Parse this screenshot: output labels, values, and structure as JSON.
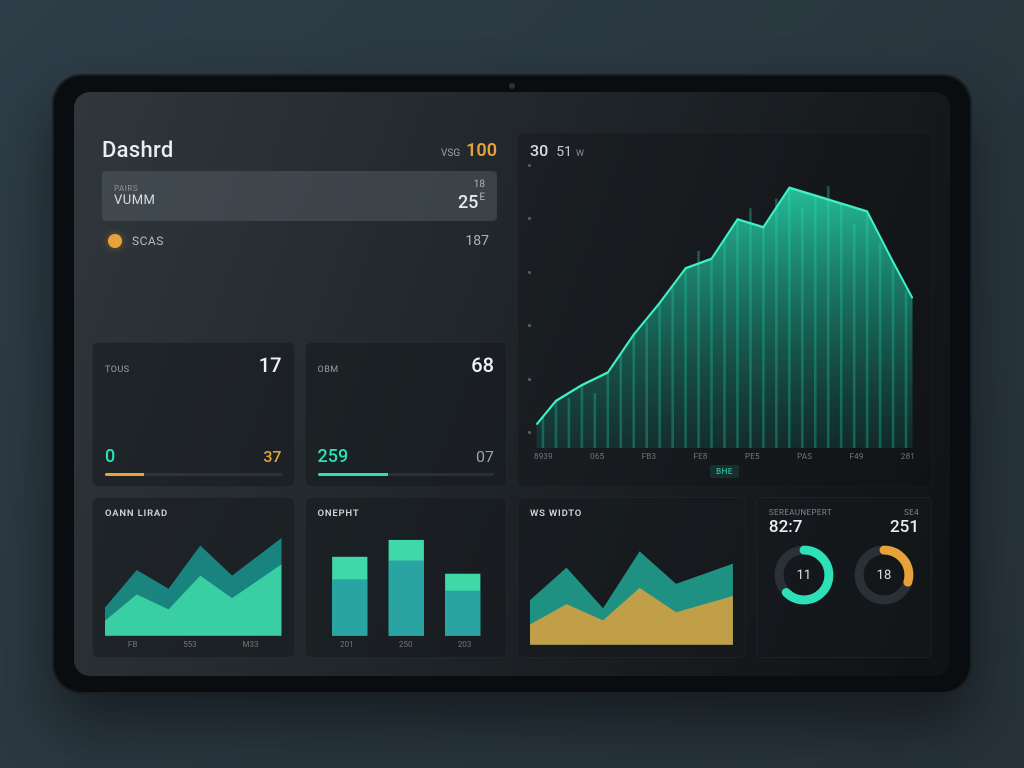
{
  "header": {
    "title": "Dashrd",
    "meta_label": "VSG",
    "meta_value": "100",
    "input_tiny": "PAIRS",
    "input_label": "VUMM",
    "input_small": "18",
    "input_main": "25",
    "input_sup": "E",
    "status_label": "SCAS",
    "status_value": "187"
  },
  "stat_cards": [
    {
      "label": "TOUS",
      "big": "17",
      "v1": "0",
      "v2": "37",
      "fill_pct": 22,
      "fill_color": "fill-orange",
      "v1_class": "teal",
      "v2_class": "orange"
    },
    {
      "label": "OBM",
      "big": "68",
      "v1": "259",
      "v2": "07",
      "fill_pct": 40,
      "fill_color": "fill-teal",
      "v1_class": "teal",
      "v2_class": "grey"
    }
  ],
  "big_chart": {
    "n1": "30",
    "n2": "51",
    "unit": "W",
    "badge": "BHE",
    "xticks": [
      "8939",
      "065",
      "FB3",
      "FE8",
      "PE5",
      "PAS",
      "F49",
      "281"
    ]
  },
  "mini_charts": {
    "a": {
      "title": "OANN LIRAD",
      "xticks": [
        "FB",
        "553",
        "M33"
      ]
    },
    "b": {
      "title": "ONEPHT",
      "xticks": [
        "201",
        "250",
        "203"
      ]
    },
    "c": {
      "title": "WS WIDTO",
      "xticks": [
        "",
        "",
        ""
      ]
    }
  },
  "kpi_panel": {
    "sub": "SEREAUNEPERT",
    "sub2": "SE4",
    "v1": "82:7",
    "v2": "251"
  },
  "donuts": [
    {
      "value": "11",
      "pct": 62,
      "color": "#2de0b8"
    },
    {
      "value": "18",
      "pct": 30,
      "color": "#e8a23a"
    }
  ],
  "chart_data": {
    "big_area": {
      "type": "area",
      "title": "",
      "x": [
        0,
        1,
        2,
        3,
        4,
        5,
        6,
        7,
        8,
        9,
        10,
        11,
        12,
        13,
        14,
        15,
        16,
        17,
        18,
        19,
        20,
        21,
        22,
        23,
        24,
        25,
        26,
        27,
        28,
        29
      ],
      "values": [
        8,
        12,
        14,
        18,
        16,
        20,
        24,
        30,
        34,
        40,
        46,
        52,
        60,
        58,
        64,
        72,
        78,
        70,
        82,
        88,
        80,
        86,
        90,
        84,
        76,
        82,
        70,
        64,
        58,
        50
      ],
      "ylim": [
        0,
        100
      ],
      "xticks": [
        "8939",
        "065",
        "FB3",
        "FE8",
        "PE5",
        "PAS",
        "F49",
        "281"
      ]
    },
    "mini_a": {
      "type": "area",
      "series": [
        {
          "name": "s1",
          "color": "#1aa0a0",
          "values": [
            30,
            55,
            40,
            70,
            50,
            80
          ]
        },
        {
          "name": "s2",
          "color": "#3fd9a8",
          "values": [
            20,
            40,
            30,
            55,
            35,
            60
          ]
        }
      ],
      "x": [
        0,
        1,
        2,
        3,
        4,
        5
      ],
      "ylim": [
        0,
        100
      ]
    },
    "mini_b": {
      "type": "bar",
      "categories": [
        "201",
        "250",
        "203"
      ],
      "series": [
        {
          "name": "a",
          "color": "#3fd9a8",
          "values": [
            70,
            85,
            55
          ]
        },
        {
          "name": "b",
          "color": "#2aa3a3",
          "values": [
            55,
            70,
            40
          ]
        }
      ],
      "ylim": [
        0,
        100
      ]
    },
    "mini_c": {
      "type": "area",
      "series": [
        {
          "name": "teal",
          "color": "#2bd3b0",
          "values": [
            40,
            60,
            35,
            70,
            50,
            65
          ]
        },
        {
          "name": "orange",
          "color": "#e8a23a",
          "values": [
            20,
            35,
            25,
            45,
            30,
            40
          ]
        }
      ],
      "x": [
        0,
        1,
        2,
        3,
        4,
        5
      ],
      "ylim": [
        0,
        100
      ]
    },
    "donuts": [
      {
        "type": "pie",
        "values": [
          62,
          38
        ],
        "center": "11"
      },
      {
        "type": "pie",
        "values": [
          30,
          70
        ],
        "center": "18"
      }
    ]
  }
}
